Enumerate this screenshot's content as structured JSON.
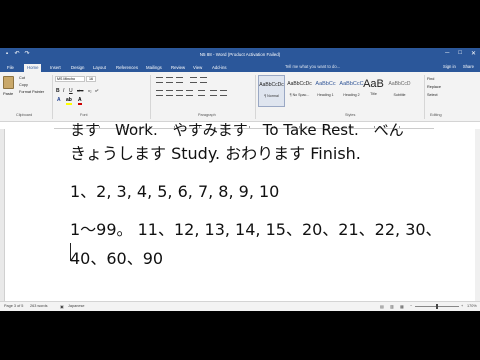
{
  "window": {
    "title": "N5   88 - Word (Product Activation Failed)",
    "min": "─",
    "max": "□",
    "close": "✕"
  },
  "qat": [
    "save-icon",
    "undo-icon",
    "redo-icon"
  ],
  "tabs": [
    "File",
    "Home",
    "Insert",
    "Design",
    "Layout",
    "References",
    "Mailings",
    "Review",
    "View",
    "Add-ins"
  ],
  "active_tab": "Home",
  "tell_me": "Tell me what you want to do...",
  "account_links": [
    "Sign in",
    "Share"
  ],
  "ribbon": {
    "clipboard": {
      "paste": "Paste",
      "cut": "Cut",
      "copy": "Copy",
      "format_painter": "Format Painter",
      "label": "Clipboard"
    },
    "font": {
      "name": "MS Mincho",
      "size": "16",
      "label": "Font",
      "buttons": [
        "B",
        "I",
        "U",
        "abc",
        "x₂",
        "x²"
      ]
    },
    "paragraph": {
      "label": "Paragraph"
    },
    "styles": {
      "label": "Styles",
      "items": [
        {
          "sample": "AaBbCcDc",
          "name": "¶ Normal"
        },
        {
          "sample": "AaBbCcDc",
          "name": "¶ No Spac..."
        },
        {
          "sample": "AaBbCc",
          "name": "Heading 1"
        },
        {
          "sample": "AaBbCcC",
          "name": "Heading 2"
        },
        {
          "sample": "AaB",
          "name": "Title"
        },
        {
          "sample": "AaBbCcD",
          "name": "Subtitle"
        }
      ]
    },
    "editing": {
      "find": "Find",
      "replace": "Replace",
      "select": "Select",
      "label": "Editing"
    }
  },
  "document": {
    "lines": [
      "ます　Work.　やすみます　To Take Rest.　べん",
      "きょうします  Study.  おわります  Finish.",
      "1、2, 3, 4, 5, 6, 7, 8, 9, 10",
      "1〜99。 11、12, 13, 14, 15、20、21、22, 30、",
      "40、60、90"
    ]
  },
  "status": {
    "page": "Page 3 of 5",
    "words": "263 words",
    "language": "Japanese",
    "zoom": "170%"
  }
}
